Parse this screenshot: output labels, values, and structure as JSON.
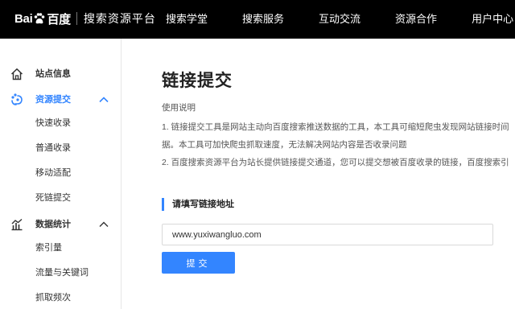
{
  "header": {
    "logo_bai": "Bai",
    "logo_du": "百度",
    "logo_sub": "搜索资源平台",
    "nav": [
      "搜索学堂",
      "搜索服务",
      "互动交流",
      "资源合作",
      "用户中心"
    ]
  },
  "sidebar": {
    "site_info": "站点信息",
    "resource_submit": {
      "label": "资源提交",
      "items": [
        "快速收录",
        "普通收录",
        "移动适配",
        "死链提交"
      ]
    },
    "data_stats": {
      "label": "数据统计",
      "items": [
        "索引量",
        "流量与关键词",
        "抓取频次"
      ]
    }
  },
  "main": {
    "title": "链接提交",
    "usage_title": "使用说明",
    "usage_lines": [
      "1. 链接提交工具是网站主动向百度搜索推送数据的工具，本工具可缩短爬虫发现网站链接时间",
      "据。本工具可加快爬虫抓取速度，无法解决网站内容是否收录问题",
      "2. 百度搜索资源平台为站长提供链接提交通道，您可以提交想被百度收录的链接，百度搜索引"
    ],
    "section_label": "请填写链接地址",
    "url_value": "www.yuxiwangluo.com",
    "submit_label": "提交"
  },
  "colors": {
    "accent": "#3385ff",
    "topbar": "#000000",
    "active_group": "#3385ff"
  },
  "icons": {
    "site_info": "home-icon",
    "resource_submit": "paw-link-icon",
    "data_stats": "bar-chart-icon"
  }
}
